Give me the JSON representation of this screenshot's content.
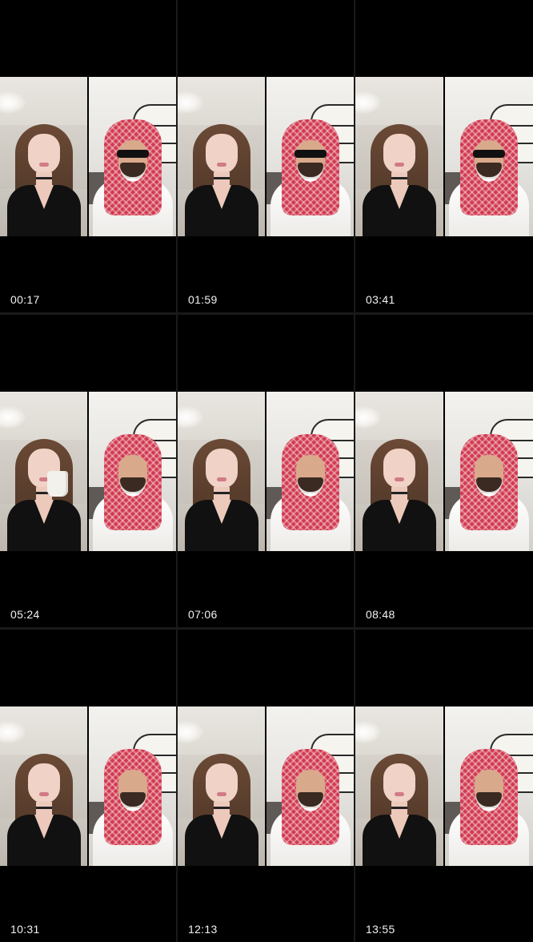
{
  "grid": {
    "thumbnails": [
      {
        "timestamp": "00:17",
        "man_sunglasses": true,
        "woman_cup": false
      },
      {
        "timestamp": "01:59",
        "man_sunglasses": true,
        "woman_cup": false
      },
      {
        "timestamp": "03:41",
        "man_sunglasses": true,
        "woman_cup": false
      },
      {
        "timestamp": "05:24",
        "man_sunglasses": false,
        "woman_cup": true
      },
      {
        "timestamp": "07:06",
        "man_sunglasses": false,
        "woman_cup": false
      },
      {
        "timestamp": "08:48",
        "man_sunglasses": false,
        "woman_cup": false
      },
      {
        "timestamp": "10:31",
        "man_sunglasses": false,
        "woman_cup": false
      },
      {
        "timestamp": "12:13",
        "man_sunglasses": false,
        "woman_cup": false
      },
      {
        "timestamp": "13:55",
        "man_sunglasses": false,
        "woman_cup": false
      }
    ]
  },
  "colors": {
    "background": "#000000",
    "timestamp_text": "#f2f2f2",
    "shemagh_red": "#d1394f",
    "thobe_white": "#ffffff",
    "dress_black": "#111111"
  }
}
